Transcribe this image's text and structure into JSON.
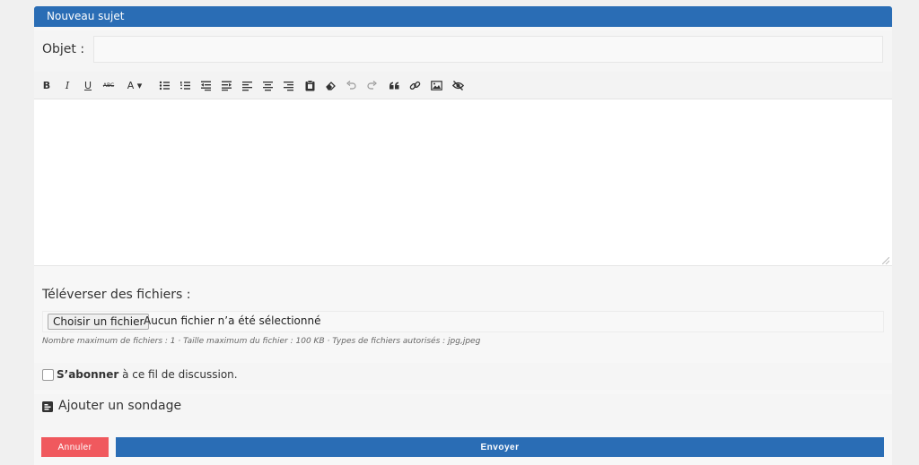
{
  "header": {
    "title": "Nouveau sujet"
  },
  "subject": {
    "label": "Objet :",
    "value": ""
  },
  "toolbar": {
    "items": [
      {
        "name": "bold",
        "glyph": "B"
      },
      {
        "name": "italic",
        "glyph": "I"
      },
      {
        "name": "underline",
        "glyph": "U"
      },
      {
        "name": "strikethrough",
        "glyph": "ABC"
      },
      {
        "name": "font-color",
        "glyph": "A ▾"
      }
    ]
  },
  "editor": {
    "content": ""
  },
  "upload": {
    "title": "Téléverser des fichiers :",
    "choose_label": "Choisir un fichier",
    "status": "Aucun fichier n’a été sélectionné",
    "hint": "Nombre maximum de fichiers : 1 · Taille maximum du fichier : 100 KB · Types de fichiers autorisés : jpg,jpeg"
  },
  "subscribe": {
    "bold": "S’abonner",
    "rest": " à ce fil de discussion.",
    "checked": false
  },
  "poll": {
    "label": "Ajouter un sondage"
  },
  "actions": {
    "cancel": "Annuler",
    "send": "Envoyer"
  },
  "colors": {
    "accent": "#2a6db5",
    "danger": "#f0595e"
  }
}
